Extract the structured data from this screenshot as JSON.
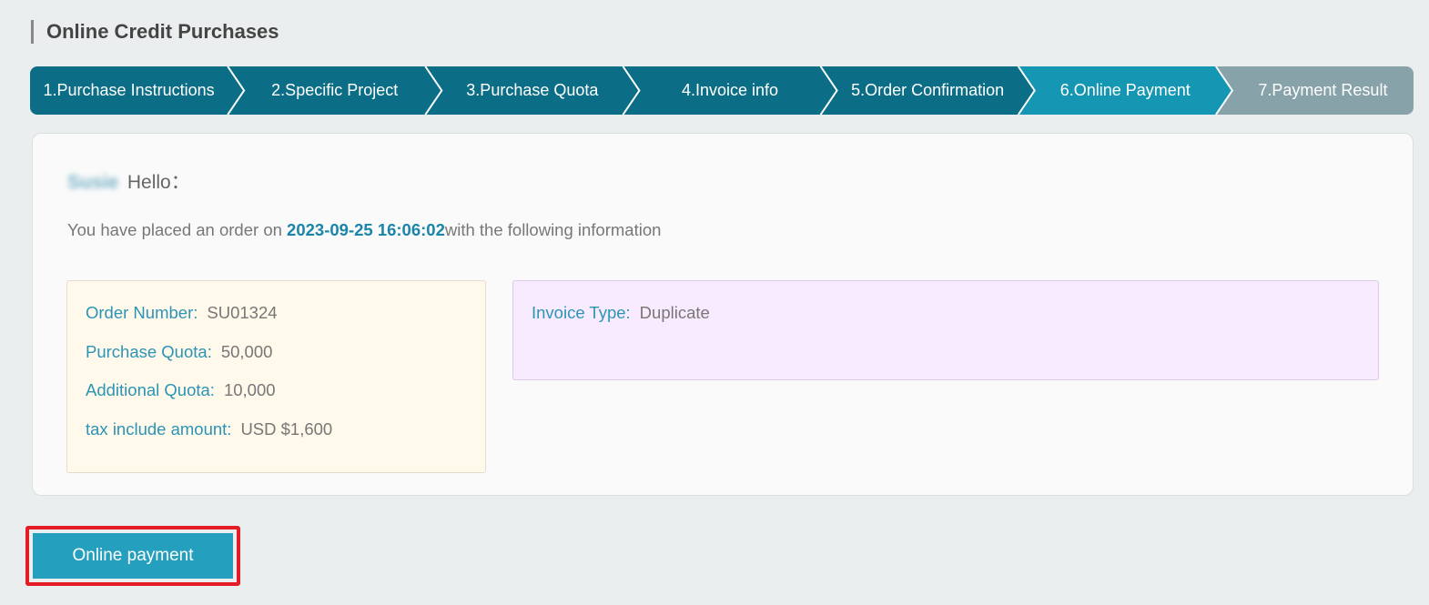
{
  "page": {
    "title": "Online Credit Purchases"
  },
  "steps": [
    {
      "label": "1.Purchase Instructions",
      "state": "done"
    },
    {
      "label": "2.Specific Project",
      "state": "done"
    },
    {
      "label": "3.Purchase Quota",
      "state": "done"
    },
    {
      "label": "4.Invoice info",
      "state": "done"
    },
    {
      "label": "5.Order Confirmation",
      "state": "done"
    },
    {
      "label": "6.Online Payment",
      "state": "current"
    },
    {
      "label": "7.Payment Result",
      "state": "pending"
    }
  ],
  "colors": {
    "step_done": "#0c6e86",
    "step_current": "#1596b3",
    "step_pending": "#87a3a9",
    "accent": "#2c94b5",
    "pay_button": "#249fbd",
    "highlight_border": "#e31c26"
  },
  "greeting": {
    "username": "Susie",
    "text": "Hello："
  },
  "order_notice": {
    "prefix": "You have placed an order on ",
    "datetime": "2023-09-25 16:06:02",
    "suffix": "with the following information"
  },
  "order": {
    "order_number": {
      "label": "Order Number:",
      "value": "SU01324"
    },
    "purchase_quota": {
      "label": "Purchase Quota:",
      "value": "50,000"
    },
    "additional_quota": {
      "label": "Additional Quota:",
      "value": "10,000"
    },
    "tax_amount": {
      "label": "tax include amount:",
      "value": "USD $1,600"
    }
  },
  "invoice": {
    "type": {
      "label": "Invoice Type:",
      "value": "Duplicate"
    }
  },
  "actions": {
    "online_payment_label": "Online payment"
  }
}
